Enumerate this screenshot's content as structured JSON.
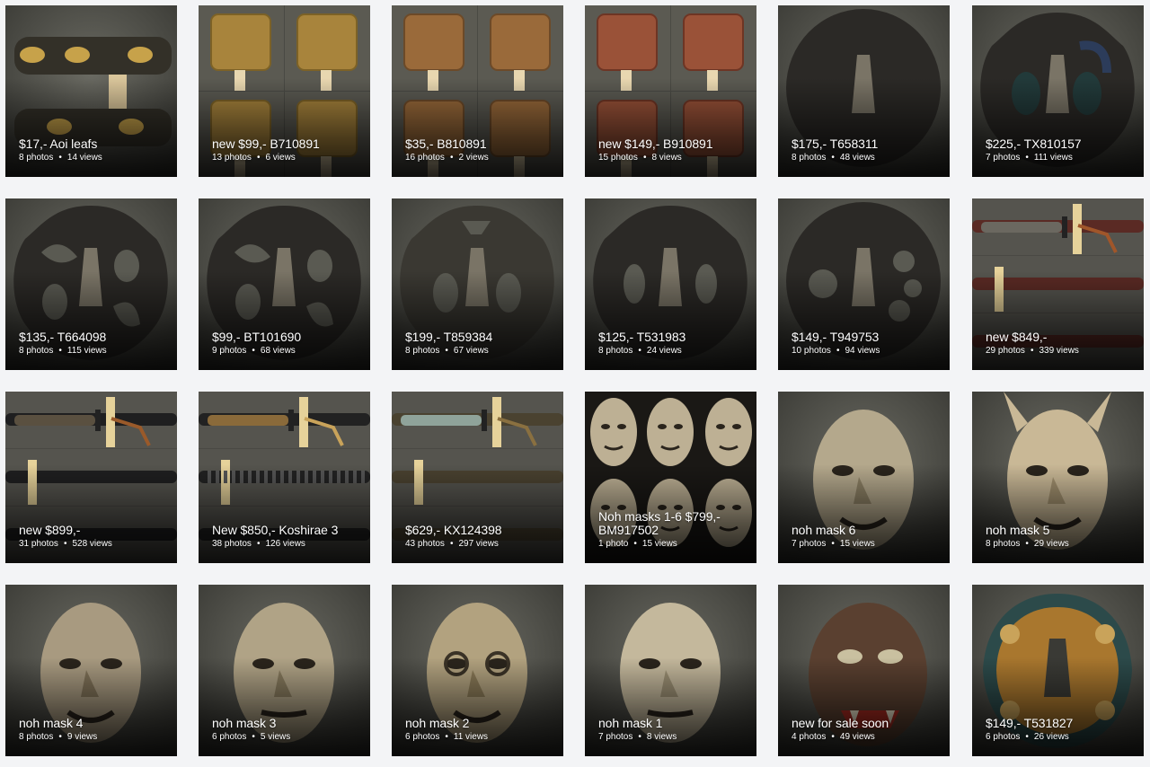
{
  "cards": [
    {
      "title": "$17,- Aoi leafs",
      "photos": "8 photos",
      "views": "14 views",
      "thumb": "fuchi-gold"
    },
    {
      "title": "new $99,- B710891",
      "photos": "13 photos",
      "views": "6 views",
      "thumb": "habaki-brass"
    },
    {
      "title": "$35,- B810891",
      "photos": "16 photos",
      "views": "2 views",
      "thumb": "habaki-copper"
    },
    {
      "title": "new $149,- B910891",
      "photos": "15 photos",
      "views": "8 views",
      "thumb": "habaki-red"
    },
    {
      "title": "$175,- T658311",
      "photos": "8 photos",
      "views": "48 views",
      "thumb": "tsuba-round"
    },
    {
      "title": "$225,- TX810157",
      "photos": "7 photos",
      "views": "111 views",
      "thumb": "tsuba-mokko-inlay"
    },
    {
      "title": "$135,- T664098",
      "photos": "8 photos",
      "views": "115 views",
      "thumb": "tsuba-openwork"
    },
    {
      "title": "$99,- BT101690",
      "photos": "9 photos",
      "views": "68 views",
      "thumb": "tsuba-openwork-2"
    },
    {
      "title": "$199,- T859384",
      "photos": "8 photos",
      "views": "67 views",
      "thumb": "tsuba-inscribed"
    },
    {
      "title": "$125,- T531983",
      "photos": "8 photos",
      "views": "24 views",
      "thumb": "tsuba-mokko"
    },
    {
      "title": "$149,- T949753",
      "photos": "10 photos",
      "views": "94 views",
      "thumb": "tsuba-flower"
    },
    {
      "title": "new $849,-",
      "photos": "29 photos",
      "views": "339 views",
      "thumb": "katana-red"
    },
    {
      "title": "new $899,-",
      "photos": "31 photos",
      "views": "528 views",
      "thumb": "katana-black"
    },
    {
      "title": "New $850,- Koshirae 3",
      "photos": "38 photos",
      "views": "126 views",
      "thumb": "koshirae-ribbed"
    },
    {
      "title": "$629,- KX124398",
      "photos": "43 photos",
      "views": "297 views",
      "thumb": "katana-gold"
    },
    {
      "title": "Noh masks 1-6 $799,- BM917502",
      "photos": "1 photo",
      "views": "15 views",
      "thumb": "noh-collage"
    },
    {
      "title": "noh mask 6",
      "photos": "7 photos",
      "views": "15 views",
      "thumb": "mask-old-man"
    },
    {
      "title": "noh mask 5",
      "photos": "8 photos",
      "views": "29 views",
      "thumb": "mask-hannya"
    },
    {
      "title": "noh mask 4",
      "photos": "8 photos",
      "views": "9 views",
      "thumb": "mask-demon"
    },
    {
      "title": "noh mask 3",
      "photos": "6 photos",
      "views": "5 views",
      "thumb": "mask-elder"
    },
    {
      "title": "noh mask 2",
      "photos": "6 photos",
      "views": "11 views",
      "thumb": "mask-goggle"
    },
    {
      "title": "noh mask 1",
      "photos": "7 photos",
      "views": "8 views",
      "thumb": "mask-young"
    },
    {
      "title": "new for sale soon",
      "photos": "4 photos",
      "views": "49 views",
      "thumb": "mask-dark-demon"
    },
    {
      "title": "$149,- T531827",
      "photos": "6 photos",
      "views": "26 views",
      "thumb": "tsuba-brass"
    }
  ],
  "colors": {
    "page_bg": "#f3f4f6",
    "caption_text": "#ffffff",
    "iron": "#2b2926",
    "brass": "#b08a3a",
    "copper": "#9a5a3a",
    "mask_tan": "#b7a58a"
  }
}
